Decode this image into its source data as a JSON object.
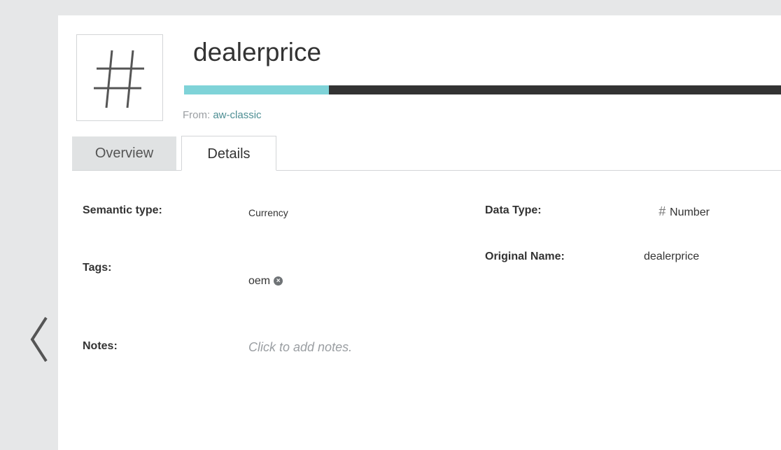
{
  "field": {
    "icon_name": "hash-icon",
    "name": "dealerprice",
    "completeness": 0.23,
    "source_label": "From:",
    "source_name": "aw-classic"
  },
  "tabs": [
    {
      "label": "Overview",
      "active": false
    },
    {
      "label": "Details",
      "active": true
    }
  ],
  "details": {
    "semantic_type_label": "Semantic type:",
    "semantic_type_value": "Currency",
    "data_type_label": "Data Type:",
    "data_type_icon": "hash-icon",
    "data_type_value": "Number",
    "tags_label": "Tags:",
    "tags": [
      "oem"
    ],
    "original_name_label": "Original Name:",
    "original_name_value": "dealerprice",
    "notes_label": "Notes:",
    "notes_placeholder": "Click to add notes."
  },
  "nav": {
    "back_icon": "chevron-left-icon"
  },
  "colors": {
    "accent": "#7fd3d8",
    "bar_track": "#333333",
    "source_link": "#4d8e93",
    "page_bg": "#e6e7e8"
  }
}
